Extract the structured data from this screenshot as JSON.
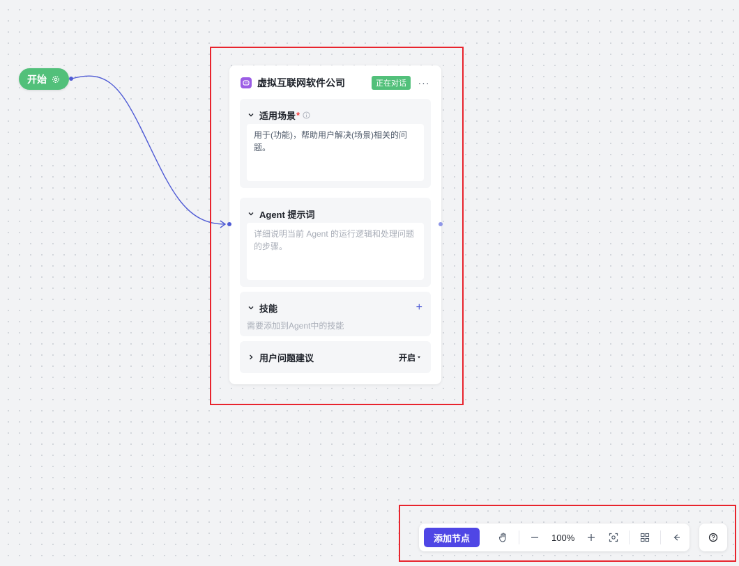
{
  "canvas": {
    "start_node": {
      "label": "开始",
      "icon": "gear-icon"
    }
  },
  "agent_card": {
    "title": "虚拟互联网软件公司",
    "status": "正在对话",
    "icon": "chat-bot-icon",
    "colors": {
      "status": "#52c07a",
      "icon": "#9b5de5",
      "accent": "#4f5bd5"
    },
    "scene": {
      "label": "适用场景",
      "required_mark": "*",
      "value": "用于(功能)，帮助用户解决(场景)相关的问题。"
    },
    "prompt": {
      "label": "Agent 提示词",
      "placeholder": "详细说明当前 Agent 的运行逻辑和处理问题的步骤。"
    },
    "skills": {
      "label": "技能",
      "hint": "需要添加到Agent中的技能"
    },
    "suggestions": {
      "label": "用户问题建议",
      "value": "开启"
    }
  },
  "toolbar": {
    "add_node_label": "添加节点",
    "zoom": "100%",
    "add_node_color": "#4f46e5"
  },
  "highlight_color": "#e8242d"
}
